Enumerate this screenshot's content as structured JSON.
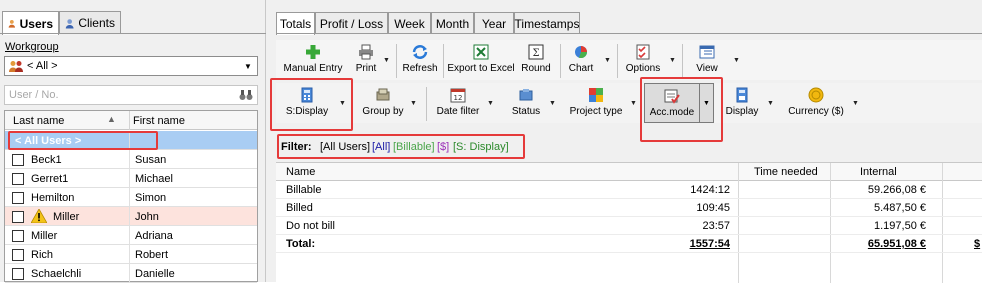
{
  "left": {
    "tabs": [
      {
        "label": "Users",
        "icon": "user-icon",
        "active": true
      },
      {
        "label": "Clients",
        "icon": "clients-icon",
        "active": false
      }
    ],
    "workgroup_label": "Workgroup",
    "workgroup_value": "< All >",
    "search_placeholder": "User / No.",
    "columns": {
      "last_name": "Last name",
      "first_name": "First name"
    },
    "all_users": "< All Users >",
    "users": [
      {
        "last": "Beck1",
        "first": "Susan",
        "warning": false
      },
      {
        "last": "Gerret1",
        "first": "Michael",
        "warning": false
      },
      {
        "last": "Hemilton",
        "first": "Simon",
        "warning": false
      },
      {
        "last": "Miller",
        "first": "John",
        "warning": true
      },
      {
        "last": "Miller",
        "first": "Adriana",
        "warning": false
      },
      {
        "last": "Rich",
        "first": "Robert",
        "warning": false
      },
      {
        "last": "Schaelchli",
        "first": "Danielle",
        "warning": false
      }
    ]
  },
  "right": {
    "tabs": [
      "Totals",
      "Profit / Loss",
      "Week",
      "Month",
      "Year",
      "Timestamps"
    ],
    "active_tab": "Totals",
    "toolbar1": [
      {
        "label": "Manual Entry",
        "icon": "plus-icon"
      },
      {
        "label": "Print",
        "icon": "printer-icon"
      },
      {
        "label": "Refresh",
        "icon": "refresh-icon"
      },
      {
        "label": "Export to Excel",
        "icon": "excel-icon"
      },
      {
        "label": "Round",
        "icon": "sigma-icon"
      },
      {
        "label": "Chart",
        "icon": "chart-icon"
      },
      {
        "label": "Options",
        "icon": "options-icon"
      },
      {
        "label": "View",
        "icon": "view-icon"
      }
    ],
    "toolbar2": [
      {
        "label": "S:Display",
        "icon": "calculator-icon"
      },
      {
        "label": "Group by",
        "icon": "group-icon"
      },
      {
        "label": "Date filter",
        "icon": "calendar-icon"
      },
      {
        "label": "Status",
        "icon": "status-icon"
      },
      {
        "label": "Project type",
        "icon": "project-type-icon"
      },
      {
        "label": "Acc.mode",
        "icon": "acc-mode-icon"
      },
      {
        "label": "Display",
        "icon": "display-icon"
      },
      {
        "label": "Currency ($)",
        "icon": "coin-icon"
      }
    ],
    "filter": {
      "label": "Filter:",
      "items": [
        {
          "text": "[All Users]",
          "color": "#000000"
        },
        {
          "text": "[All]",
          "color": "#1a1aa6"
        },
        {
          "text": "[Billable]",
          "color": "#4aa54a"
        },
        {
          "text": "[$]",
          "color": "#9b30b8"
        },
        {
          "text": "[S: Display]",
          "color": "#2c8a2c"
        }
      ]
    },
    "table": {
      "headers": [
        "Name",
        "Time needed",
        "Internal"
      ],
      "rows": [
        {
          "name": "Billable",
          "time": "1424:12",
          "internal": "59.266,08 €"
        },
        {
          "name": "Billed",
          "time": "109:45",
          "internal": "5.487,50 €"
        },
        {
          "name": "Do not bill",
          "time": "23:57",
          "internal": "1.197,50 €"
        }
      ],
      "total": {
        "name": "Total:",
        "time": "1557:54",
        "internal": "65.951,08 €",
        "extra": "$"
      }
    }
  }
}
